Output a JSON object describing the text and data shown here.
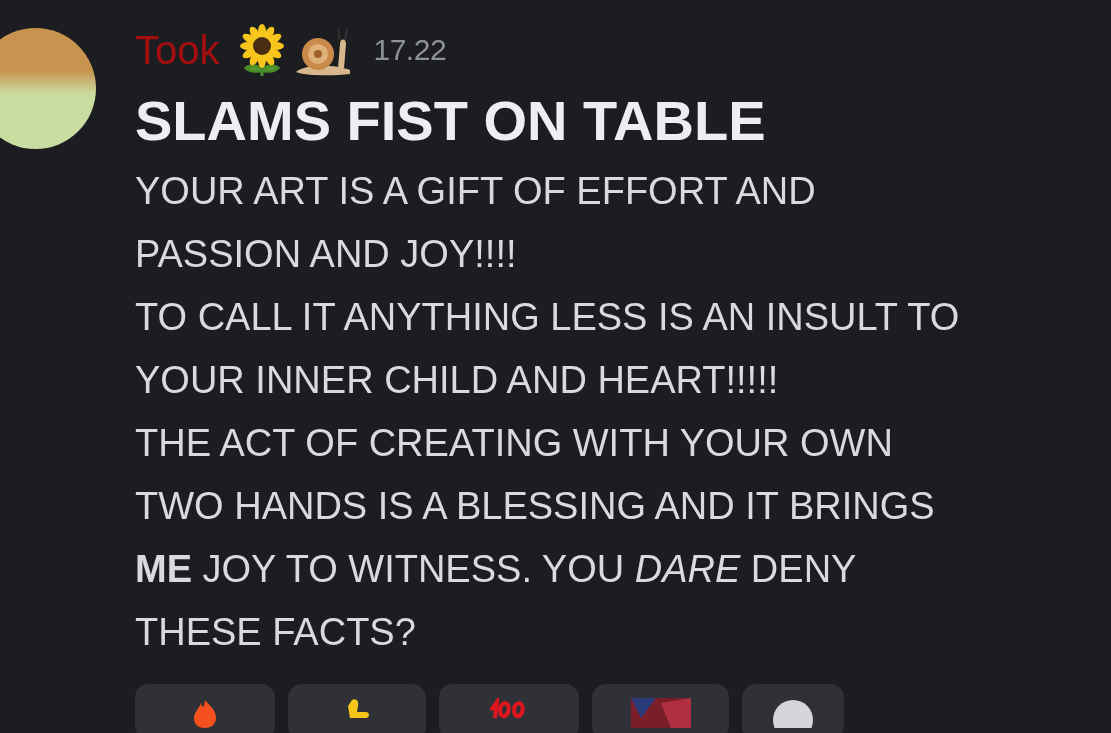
{
  "message": {
    "author": "Took",
    "timestamp": "17.22",
    "heading": "SLAMS FIST ON TABLE",
    "lines": [
      "YOUR ART IS A GIFT OF EFFORT AND",
      "PASSION AND JOY!!!!",
      "TO CALL IT ANYTHING LESS IS AN INSULT TO",
      "YOUR INNER CHILD AND HEART!!!!!",
      "THE ACT OF CREATING WITH YOUR OWN",
      "TWO HANDS IS A BLESSING AND IT BRINGS",
      "**ME** JOY TO WITNESS. YOU *DARE* DENY",
      "THESE FACTS?"
    ]
  },
  "reactions": [
    {
      "kind": "flame"
    },
    {
      "kind": "thumb"
    },
    {
      "kind": "hundred"
    },
    {
      "kind": "custom"
    },
    {
      "kind": "add"
    }
  ]
}
